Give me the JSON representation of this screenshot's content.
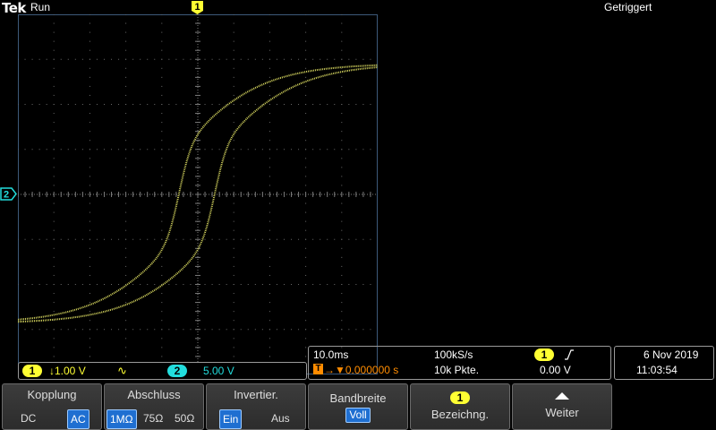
{
  "header": {
    "brand": "Tek",
    "run_state": "Run",
    "trigger_status": "Getriggert"
  },
  "markers": {
    "ch1": "1",
    "ch2": "2"
  },
  "channels": {
    "ch1_number": "1",
    "ch1_scale": "↓1.00 V",
    "ch1_coupling_symbol": "∿",
    "ch2_number": "2",
    "ch2_scale": "5.00 V"
  },
  "timebase": {
    "scale": "10.0ms",
    "sample_rate": "100kS/s",
    "trigger_position": "→▼0.000000 s",
    "record_length": "10k Pkte.",
    "trigger_source": "1",
    "trigger_slope": "⎰",
    "trigger_level": "0.00 V"
  },
  "datetime": {
    "date": "6 Nov 2019",
    "time": "11:03:54"
  },
  "menu": {
    "coupling": {
      "title": "Kopplung",
      "opt1": "DC",
      "opt2": "AC"
    },
    "termination": {
      "title": "Abschluss",
      "opt1": "1MΩ",
      "opt2": "75Ω",
      "opt3": "50Ω"
    },
    "invert": {
      "title": "Invertier.",
      "opt1": "Ein",
      "opt2": "Aus"
    },
    "bandwidth": {
      "title": "Bandbreite",
      "value": "Voll"
    },
    "label": {
      "badge": "1",
      "title": "Bezeichng."
    },
    "more": {
      "title": "Weiter"
    }
  },
  "colors": {
    "ch1": "#ffff33",
    "ch2": "#22dddd",
    "trace": "#d8d860",
    "trigger": "#ff8c00",
    "selected": "#1f6fd1"
  }
}
